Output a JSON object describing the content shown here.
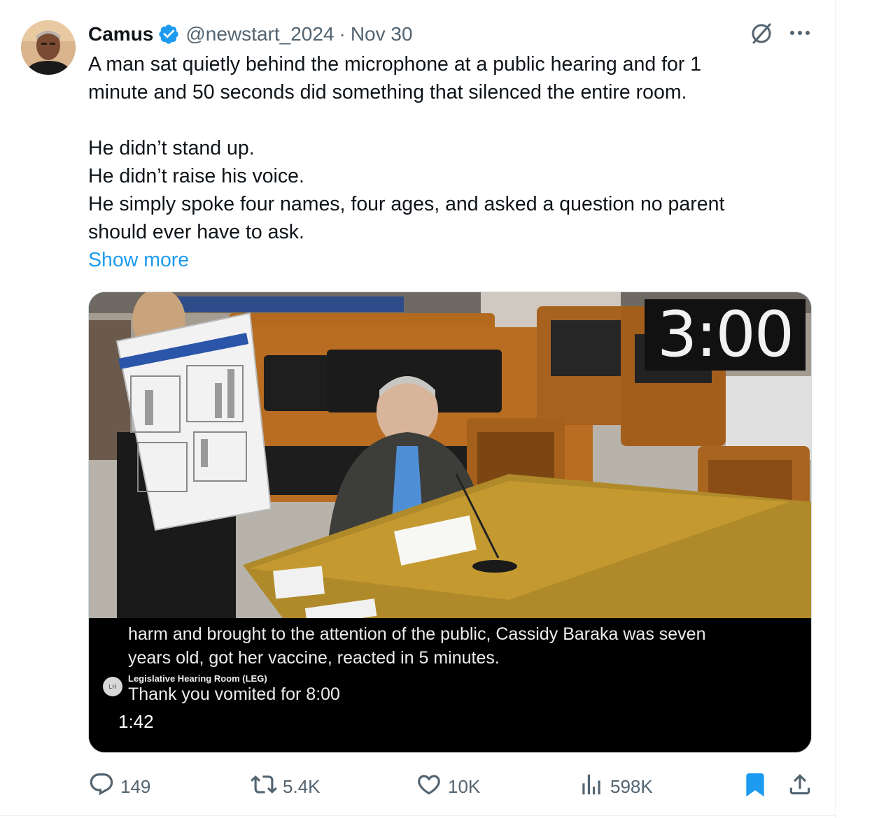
{
  "tweet": {
    "author_name": "Camus",
    "handle": "@newstart_2024",
    "separator": "·",
    "date": "Nov 30",
    "text_p1": "A man sat quietly behind the microphone at a public hearing and for 1\nminute and 50 seconds did something that silenced the entire room.",
    "text_p2": "He didn’t stand up.\nHe didn’t raise his voice.\nHe simply spoke four names, four ages, and asked a question no parent\nshould ever have to ask.",
    "show_more": "Show more"
  },
  "media": {
    "timer_overlay": "3:00",
    "caption_line1": "harm and brought to the attention of the public, Cassidy Baraka was seven\nyears old, got her vaccine, reacted in 5 minutes.",
    "caption_source": "Legislative Hearing Room (LEG)",
    "caption_line2": "Thank you vomited for 8:00",
    "duration": "1:42"
  },
  "actions": {
    "replies": "149",
    "reposts": "5.4K",
    "likes": "10K",
    "views": "598K"
  },
  "colors": {
    "accent": "#1d9bf0",
    "muted": "#536471",
    "text": "#0f1419"
  },
  "icons": [
    "verified-badge-icon",
    "grok-icon",
    "more-icon",
    "reply-icon",
    "repost-icon",
    "like-icon",
    "views-icon",
    "bookmark-icon",
    "share-icon"
  ]
}
